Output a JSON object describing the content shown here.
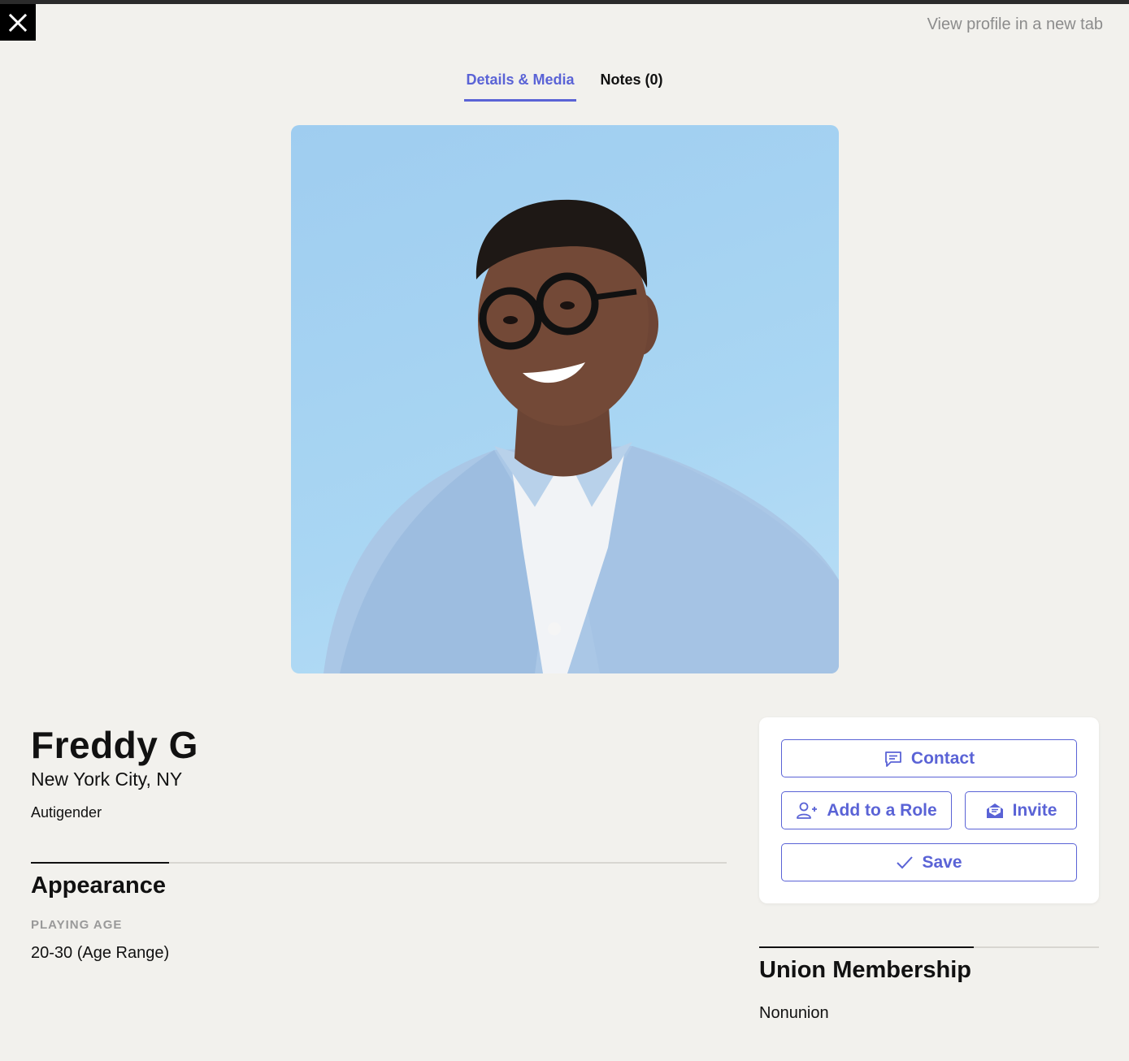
{
  "header": {
    "close_icon": "close-icon",
    "new_tab_link": "View profile in a new tab"
  },
  "tabs": [
    {
      "label": "Details & Media",
      "active": true
    },
    {
      "label": "Notes (0)",
      "active": false
    }
  ],
  "profile": {
    "name": "Freddy G",
    "location": "New York City, NY",
    "gender": "Autigender"
  },
  "appearance": {
    "title": "Appearance",
    "playing_age_label": "PLAYING AGE",
    "playing_age_value": "20-30 (Age Range)"
  },
  "actions": {
    "contact": {
      "label": "Contact",
      "icon": "message-icon"
    },
    "add_to_role": {
      "label": "Add to a Role",
      "icon": "user-plus-icon"
    },
    "invite": {
      "label": "Invite",
      "icon": "envelope-open-icon"
    },
    "save": {
      "label": "Save",
      "icon": "check-icon"
    }
  },
  "union": {
    "title": "Union Membership",
    "value": "Nonunion"
  },
  "colors": {
    "accent": "#5a63d6",
    "background": "#f2f1ed",
    "muted": "#8c8c8c"
  }
}
